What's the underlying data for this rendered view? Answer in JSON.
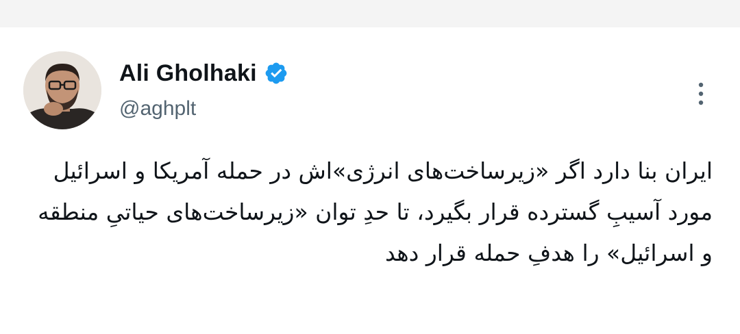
{
  "tweet": {
    "author": {
      "name": "Ali Gholhaki",
      "handle": "@aghplt",
      "verified": true
    },
    "text": "ایران بنا دارد اگر «زیرساخت‌های انرژی»اش در حمله آمریکا و اسرائیل مورد آسیبِ گسترده قرار بگیرد، تا حدِ توان «زیرساخت‌های حیاتیِ منطقه و اسرائیل» را هدفِ حمله قرار دهد"
  },
  "colors": {
    "verified_blue": "#1d9bf0",
    "text": "#0f1419",
    "secondary_text": "#536471"
  },
  "icons": {
    "verified": "verified-badge-icon",
    "more": "more-vertical-icon"
  }
}
